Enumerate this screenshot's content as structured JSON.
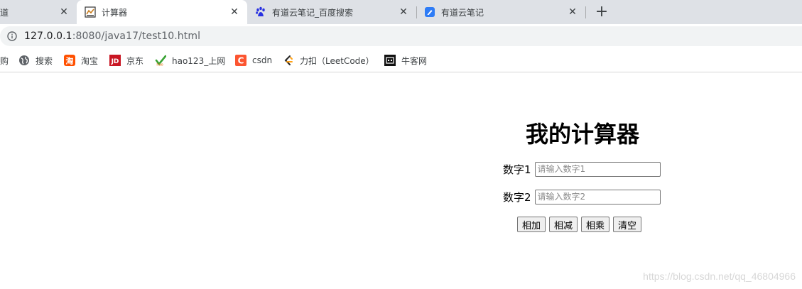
{
  "browser": {
    "tabs": [
      {
        "title": "道",
        "active": false
      },
      {
        "title": "计算器",
        "active": true
      },
      {
        "title": "有道云笔记_百度搜索",
        "active": false,
        "icon": "baidu-paw-icon"
      },
      {
        "title": "有道云笔记",
        "active": false,
        "icon": "youdao-note-icon"
      }
    ],
    "close_glyph": "✕",
    "new_tab_glyph": "+",
    "address": {
      "host": "127.0.0.1",
      "rest": ":8080/java17/test10.html"
    },
    "bookmarks": [
      {
        "label": "购",
        "icon": "none"
      },
      {
        "label": "搜索",
        "icon": "globe-icon"
      },
      {
        "label": "淘宝",
        "icon": "taobao-icon"
      },
      {
        "label": "京东",
        "icon": "jd-icon"
      },
      {
        "label": "hao123_上网",
        "icon": "hao123-icon"
      },
      {
        "label": "csdn",
        "icon": "csdn-icon"
      },
      {
        "label": "力扣（LeetCode）",
        "icon": "leetcode-icon"
      },
      {
        "label": "牛客网",
        "icon": "nowcoder-icon"
      }
    ]
  },
  "page": {
    "title": "我的计算器",
    "num1": {
      "label": "数字1",
      "placeholder": "请输入数字1",
      "value": ""
    },
    "num2": {
      "label": "数字2",
      "placeholder": "请输入数字2",
      "value": ""
    },
    "buttons": {
      "add": "相加",
      "sub": "相减",
      "mul": "相乘",
      "clear": "清空"
    },
    "watermark": "https://blog.csdn.net/qq_46804966"
  },
  "colors": {
    "tabstrip": "#dee1e6",
    "omnibox": "#f1f3f4",
    "csdn": "#fc5531",
    "jd": "#c91623",
    "taobao": "#ff5000"
  }
}
